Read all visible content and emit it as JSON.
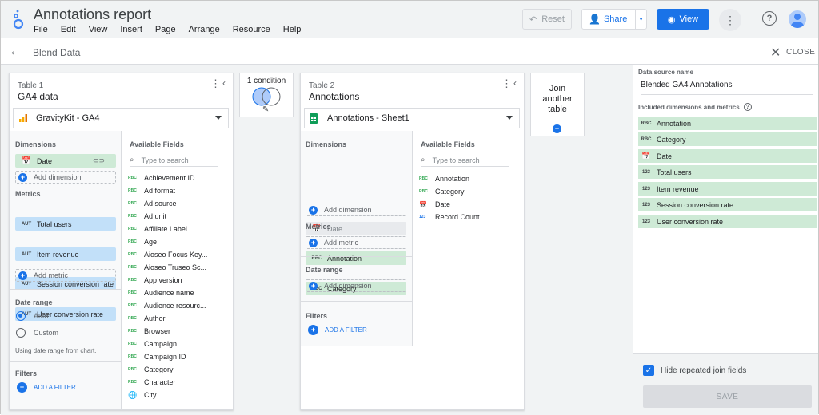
{
  "app": {
    "title": "Annotations report",
    "menu": [
      "File",
      "Edit",
      "View",
      "Insert",
      "Page",
      "Arrange",
      "Resource",
      "Help"
    ],
    "reset_label": "Reset",
    "share_label": "Share",
    "view_label": "View"
  },
  "subbar": {
    "title": "Blend Data",
    "close_label": "CLOSE"
  },
  "table1": {
    "label": "Table 1",
    "name": "GA4 data",
    "source": "GravityKit - GA4",
    "dimensions_label": "Dimensions",
    "dimensions": [
      {
        "icon": "calendar-icon",
        "label": "Date"
      }
    ],
    "add_dimension": "Add dimension",
    "metrics_label": "Metrics",
    "metrics": [
      {
        "icon": "AUT",
        "label": "Total users"
      },
      {
        "icon": "AUT",
        "label": "Item revenue"
      },
      {
        "icon": "AUT",
        "label": "Session conversion rate"
      },
      {
        "icon": "AUT",
        "label": "User conversion rate"
      }
    ],
    "add_metric": "Add metric",
    "date_range_label": "Date range",
    "date_auto": "Auto",
    "date_custom": "Custom",
    "date_note": "Using date range from chart.",
    "filters_label": "Filters",
    "add_filter": "ADD A FILTER",
    "available_label": "Available Fields",
    "search_placeholder": "Type to search",
    "fields": [
      {
        "t": "RBC",
        "label": "Achievement ID"
      },
      {
        "t": "RBC",
        "label": "Ad format"
      },
      {
        "t": "RBC",
        "label": "Ad source"
      },
      {
        "t": "RBC",
        "label": "Ad unit"
      },
      {
        "t": "RBC",
        "label": "Affiliate Label"
      },
      {
        "t": "RBC",
        "label": "Age"
      },
      {
        "t": "RBC",
        "label": "Aioseo Focus Key..."
      },
      {
        "t": "RBC",
        "label": "Aioseo Truseo Sc..."
      },
      {
        "t": "RBC",
        "label": "App version"
      },
      {
        "t": "RBC",
        "label": "Audience name"
      },
      {
        "t": "RBC",
        "label": "Audience resourc..."
      },
      {
        "t": "RBC",
        "label": "Author"
      },
      {
        "t": "RBC",
        "label": "Browser"
      },
      {
        "t": "RBC",
        "label": "Campaign"
      },
      {
        "t": "RBC",
        "label": "Campaign ID"
      },
      {
        "t": "RBC",
        "label": "Category"
      },
      {
        "t": "RBC",
        "label": "Character"
      },
      {
        "t": "globe",
        "label": "City"
      }
    ]
  },
  "condition": {
    "label": "1 condition"
  },
  "table2": {
    "label": "Table 2",
    "name": "Annotations",
    "source": "Annotations - Sheet1",
    "dimensions_label": "Dimensions",
    "dimensions": [
      {
        "icon": "calendar-icon",
        "label": "Date",
        "style": "gray"
      },
      {
        "icon": "RBC",
        "label": "Annotation",
        "style": "green"
      },
      {
        "icon": "RBC",
        "label": "Category",
        "style": "green"
      }
    ],
    "add_dimension": "Add dimension",
    "metrics_label": "Metrics",
    "add_metric": "Add metric",
    "date_range_label": "Date range",
    "add_date_dimension": "Add dimension",
    "filters_label": "Filters",
    "add_filter": "ADD A FILTER",
    "available_label": "Available Fields",
    "search_placeholder": "Type to search",
    "fields": [
      {
        "t": "RBC",
        "label": "Annotation"
      },
      {
        "t": "RBC",
        "label": "Category"
      },
      {
        "t": "cal",
        "label": "Date"
      },
      {
        "t": "123",
        "label": "Record Count"
      }
    ]
  },
  "join": {
    "label": "Join another table"
  },
  "right": {
    "source_name_label": "Data source name",
    "source_name": "Blended GA4 Annotations",
    "included_label": "Included dimensions and metrics",
    "included": [
      {
        "icon": "RBC",
        "label": "Annotation"
      },
      {
        "icon": "RBC",
        "label": "Category"
      },
      {
        "icon": "calendar-icon",
        "label": "Date"
      },
      {
        "icon": "123",
        "label": "Total users"
      },
      {
        "icon": "123",
        "label": "Item revenue"
      },
      {
        "icon": "123",
        "label": "Session conversion rate"
      },
      {
        "icon": "123",
        "label": "User conversion rate"
      }
    ],
    "hide_label": "Hide repeated join fields",
    "save_label": "SAVE"
  },
  "colors": {
    "accent": "#1a73e8",
    "dimension_chip": "#ceead6",
    "metric_chip": "#c2e0f9"
  }
}
